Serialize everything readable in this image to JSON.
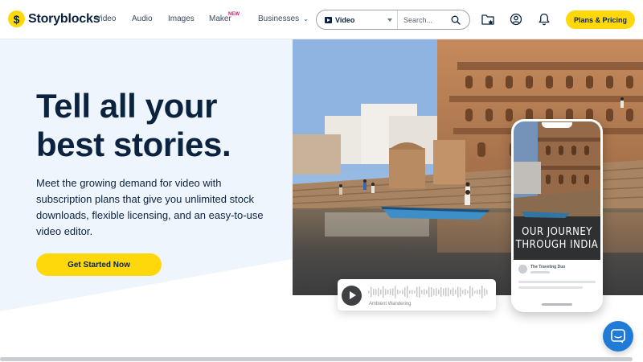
{
  "brand": {
    "name": "Storyblocks",
    "mark": "$",
    "accent": "#ffd80b",
    "navy": "#0c2340"
  },
  "nav": {
    "links": {
      "video": "Video",
      "audio": "Audio",
      "images": "Images",
      "maker": "Maker",
      "maker_badge": "NEW",
      "businesses": "Businesses"
    },
    "search": {
      "type_label": "Video",
      "placeholder": "Search..."
    },
    "plans_label": "Plans & Pricing",
    "icons": [
      "collections-star-icon",
      "account-icon",
      "bell-icon"
    ]
  },
  "hero": {
    "headline_line1": "Tell all your",
    "headline_line2": "best stories.",
    "subtext": "Meet the growing demand for video with subscription plans that give you unlimited stock downloads, flexible licensing, and an easy-to-use video editor.",
    "cta_label": "Get Started Now"
  },
  "phone": {
    "title_line1": "OUR JOURNEY",
    "title_line2": "THROUGH INDIA",
    "profile_name": "The Traveling Duo"
  },
  "audio_card": {
    "title": "Ambient Wandering"
  }
}
